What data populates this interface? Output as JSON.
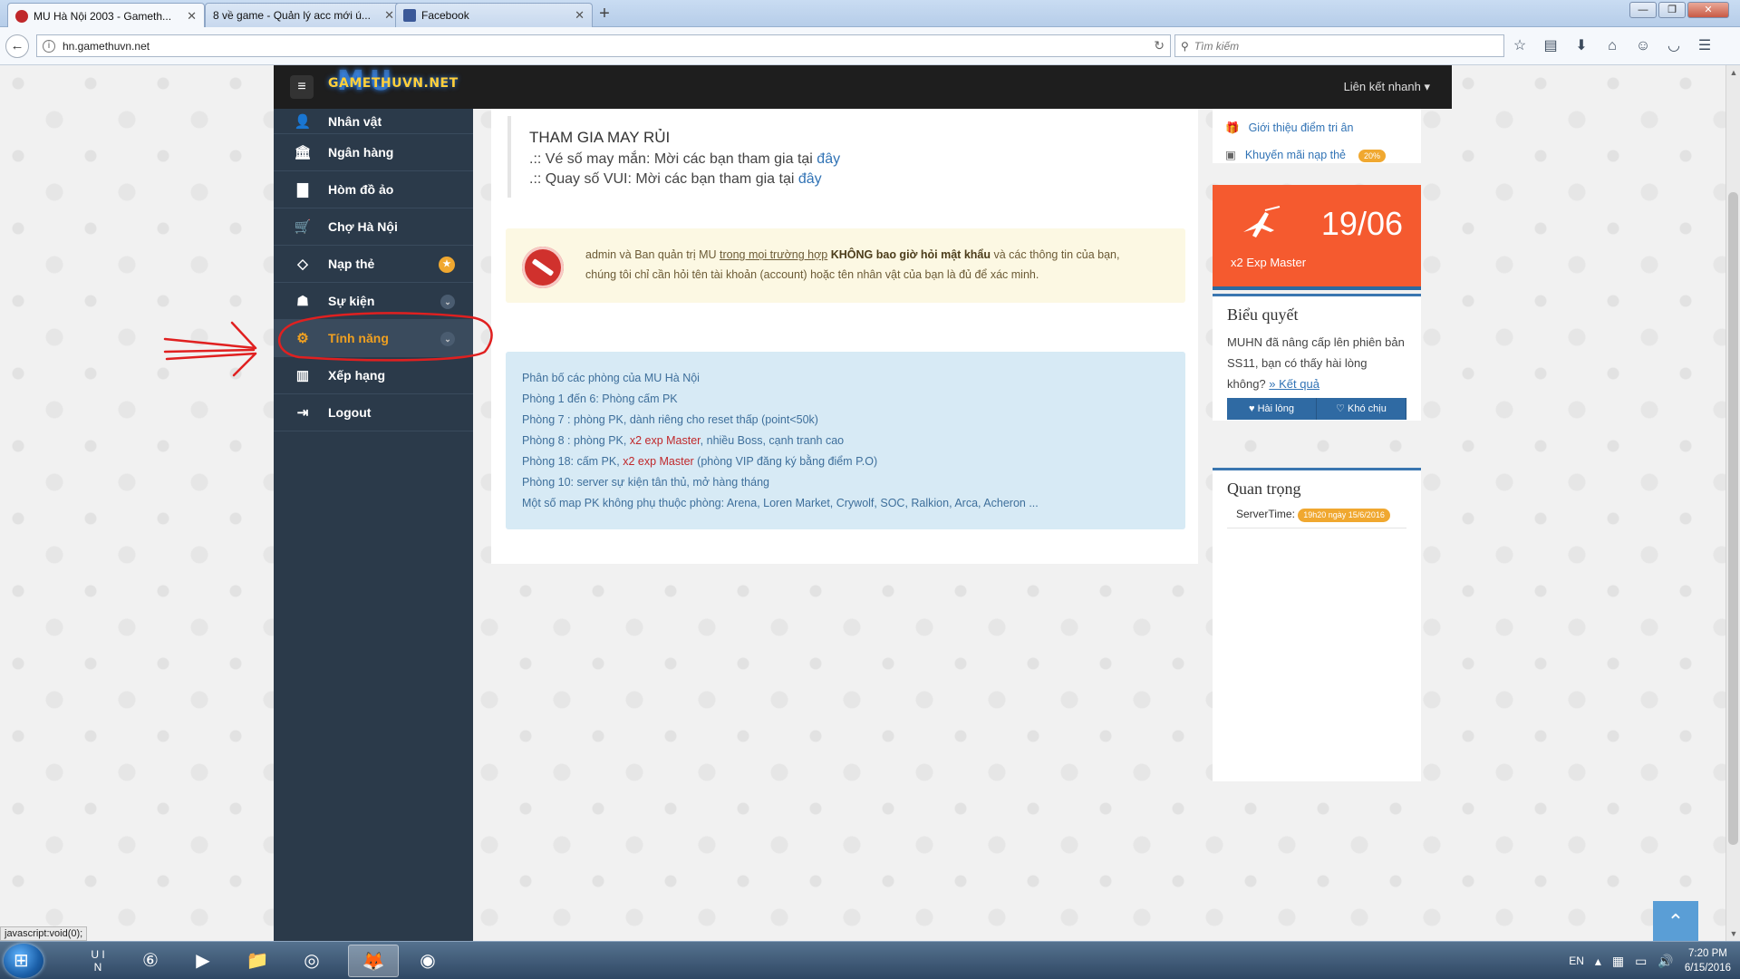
{
  "browser": {
    "tabs": [
      {
        "title": "MU Hà Nội 2003 - Gameth...",
        "favicon_color": "#c0282b"
      },
      {
        "title": "8 về game - Quản lý acc mới ú...",
        "favicon_color": "#ffffff"
      },
      {
        "title": "Facebook",
        "favicon_color": "#3b5998"
      }
    ],
    "new_tab": "+",
    "url": "hn.gamethuvn.net",
    "search_placeholder": "Tìm kiếm",
    "window_buttons": {
      "minimize": "—",
      "maximize": "❐",
      "close": "✕"
    }
  },
  "site": {
    "logo_text": "GAMETHUVN.NET",
    "logo_mu": "MU",
    "quick_links": "Liên kết nhanh ▾"
  },
  "sidebar": {
    "items": [
      {
        "label": "Nhân vật",
        "icon": "user-icon",
        "glyph": "👤"
      },
      {
        "label": "Ngân hàng",
        "icon": "bank-icon",
        "glyph": "🏛"
      },
      {
        "label": "Hòm đồ ảo",
        "icon": "chest-icon",
        "glyph": "▇"
      },
      {
        "label": "Chợ Hà Nội",
        "icon": "cart-icon",
        "glyph": "🛒"
      },
      {
        "label": "Nạp thẻ",
        "icon": "diamond-icon",
        "glyph": "◇"
      },
      {
        "label": "Sự kiện",
        "icon": "event-icon",
        "glyph": "☗"
      },
      {
        "label": "Tính năng",
        "icon": "gears-icon",
        "glyph": "⚙"
      },
      {
        "label": "Xếp hạng",
        "icon": "ranking-icon",
        "glyph": "▥"
      },
      {
        "label": "Logout",
        "icon": "logout-icon",
        "glyph": "⇥"
      }
    ],
    "star_badge": "★",
    "chevron": "⌄"
  },
  "main": {
    "luck": {
      "title": "THAM GIA MAY RỦI",
      "line1_text": ".:: Vé số may mắn: Mời các bạn tham gia tại ",
      "line1_link": "đây",
      "line2_text": ".:: Quay số VUI: Mời các bạn tham gia tại ",
      "line2_link": "đây"
    },
    "warning": {
      "part1": "admin và Ban quản trị MU ",
      "underlined": "trong mọi trường hợp",
      "bold": " KHÔNG bao giờ hỏi mật khẩu",
      "part2": " và các thông tin của bạn,",
      "line2": "chúng tôi chỉ cần hỏi tên tài khoản (account) hoặc tên nhân vật của bạn là đủ để xác minh."
    },
    "rooms": {
      "title": "Phân bố các phòng của MU Hà Nội",
      "line1": "Phòng 1 đến 6: Phòng cấm PK",
      "line2": "Phòng 7 : phòng PK, dành riêng cho reset thấp (point<50k)",
      "line3_a": "Phòng 8 : phòng PK, ",
      "line3_red": "x2 exp Master",
      "line3_b": ", nhiều Boss, cạnh tranh cao",
      "line4_a": "Phòng 18: cấm PK, ",
      "line4_red": "x2 exp Master",
      "line4_b": " (phòng VIP đăng ký bằng điểm P.O)",
      "line5": "Phòng 10: server sự kiện tân thủ, mở hàng tháng",
      "line6": "Một số map PK không phụ thuộc phòng: Arena, Loren Market, Crywolf, SOC, Ralkion, Arca, Acheron ..."
    }
  },
  "rightcol": {
    "link1": "Giới thiệu điểm tri ân",
    "link2": "Khuyến mãi nạp thẻ",
    "badge": "20%",
    "exp_date": "19/06",
    "exp_label": "x2 Exp Master",
    "poll": {
      "title": "Biểu quyết",
      "question": "MUHN đã nâng cấp lên phiên bản SS11, bạn có thấy hài lòng không?",
      "result_link": "» Kết quả",
      "btn_yes": "♥ Hài lòng",
      "btn_no": "♡ Khó chịu"
    },
    "important": {
      "title": "Quan trọng",
      "servertime_label": "ServerTime:",
      "servertime_value": "19h20 ngày 15/6/2016"
    }
  },
  "status_url": "javascript:void(0);",
  "back_to_top": "⌃",
  "taskbar": {
    "lang": "EN",
    "time": "7:20 PM",
    "date": "6/15/2016"
  },
  "colors": {
    "sidebar_bg": "#2b3a4a",
    "active_item": "#f0a020",
    "exp_tile": "#f55a2f",
    "annotation": "#e02020"
  }
}
